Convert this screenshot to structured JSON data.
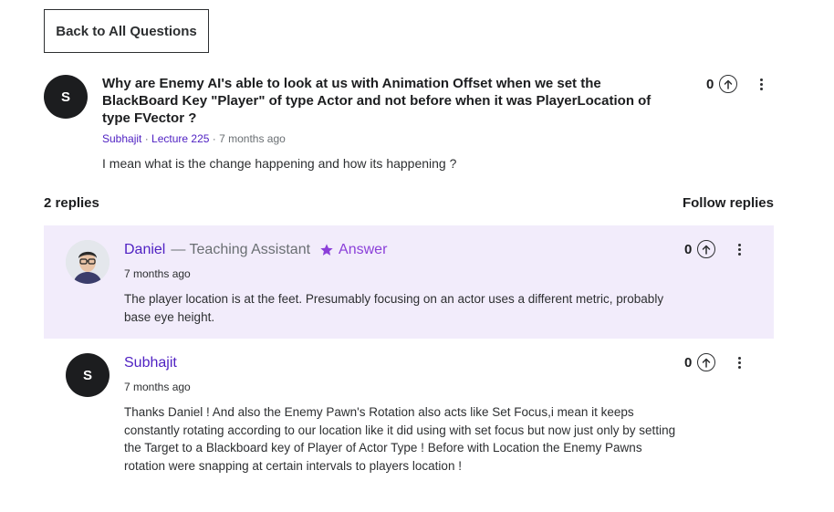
{
  "back_button": {
    "label": "Back to All Questions"
  },
  "question": {
    "avatar_initial": "S",
    "title": "Why are Enemy AI's able to look at us with Animation Offset when we set the BlackBoard Key \"Player\" of type Actor and not before when it was PlayerLocation of type FVector ?",
    "author": "Subhajit",
    "separator": " · ",
    "lecture": "Lecture 225",
    "time_ago": "7 months ago",
    "body": "I mean what is the change happening and how its happening ?",
    "votes": "0"
  },
  "replies_header": {
    "count_label": "2 replies",
    "follow_label": "Follow replies"
  },
  "replies": [
    {
      "name": "Daniel",
      "role": "— Teaching Assistant",
      "badge": "Answer",
      "time_ago": "7 months ago",
      "body": "The player location is at the feet. Presumably focusing on an actor uses a different metric, probably base eye height.",
      "votes": "0",
      "avatar_icon": "user-photo"
    },
    {
      "name": "Subhajit",
      "avatar_initial": "S",
      "time_ago": "7 months ago",
      "body": "Thanks Daniel ! And also the Enemy Pawn's Rotation also acts like Set Focus,i mean it keeps constantly rotating according to our location like it did using with set focus but now just only by setting the Target to a Blackboard key of Player of Actor Type ! Before with Location the Enemy Pawns rotation were snapping at certain intervals to players location !",
      "votes": "0"
    }
  ],
  "colors": {
    "accent": "#5022c3",
    "answer": "#8b3fd9",
    "ta_background": "#f2ecfb",
    "avatar_bg": "#1c1d1f"
  }
}
